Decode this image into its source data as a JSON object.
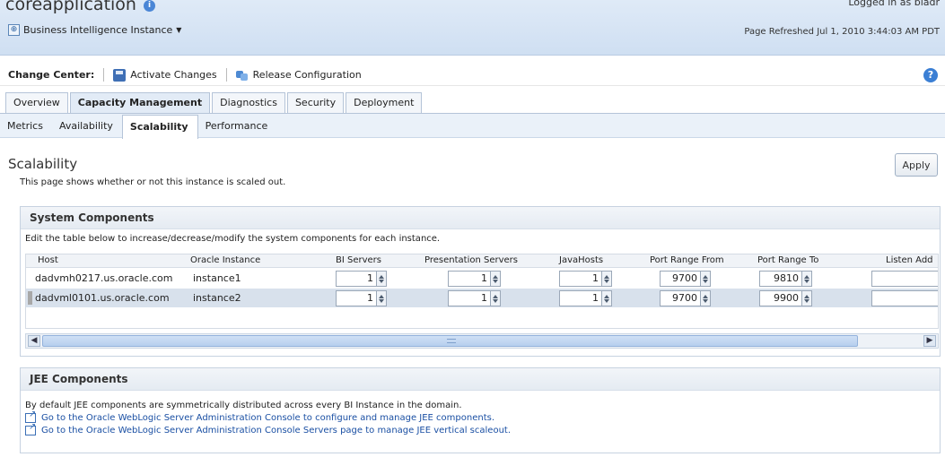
{
  "header": {
    "title": "coreapplication",
    "instance_menu": "Business Intelligence Instance",
    "logged_in": "Logged in as  biadr",
    "refreshed": "Page Refreshed Jul 1, 2010 3:44:03 AM PDT"
  },
  "change_center": {
    "label": "Change Center:",
    "activate": "Activate Changes",
    "release": "Release Configuration",
    "help": "?"
  },
  "tabs": [
    "Overview",
    "Capacity Management",
    "Diagnostics",
    "Security",
    "Deployment"
  ],
  "subtabs": [
    "Metrics",
    "Availability",
    "Scalability",
    "Performance"
  ],
  "page": {
    "title": "Scalability",
    "description": "This page shows whether or not this instance is scaled out.",
    "apply": "Apply"
  },
  "system_components": {
    "title": "System Components",
    "description": "Edit the table below to increase/decrease/modify the system components for each instance.",
    "columns": [
      "Host",
      "Oracle Instance",
      "BI Servers",
      "Presentation Servers",
      "JavaHosts",
      "Port Range From",
      "Port Range To",
      "Listen Add"
    ],
    "rows": [
      {
        "host": "dadvmh0217.us.oracle.com",
        "instance": "instance1",
        "bi_servers": "1",
        "presentation_servers": "1",
        "javahosts": "1",
        "port_from": "9700",
        "port_to": "9810",
        "listen": ""
      },
      {
        "host": "dadvml0101.us.oracle.com",
        "instance": "instance2",
        "bi_servers": "1",
        "presentation_servers": "1",
        "javahosts": "1",
        "port_from": "9700",
        "port_to": "9900",
        "listen": ""
      }
    ]
  },
  "jee_components": {
    "title": "JEE Components",
    "description": "By default JEE components are symmetrically distributed across every BI Instance in the domain.",
    "link1": "Go to the Oracle WebLogic Server Administration Console to configure and manage JEE components.",
    "link2": "Go to the Oracle WebLogic Server Administration Console Servers page to manage JEE vertical scaleout."
  }
}
